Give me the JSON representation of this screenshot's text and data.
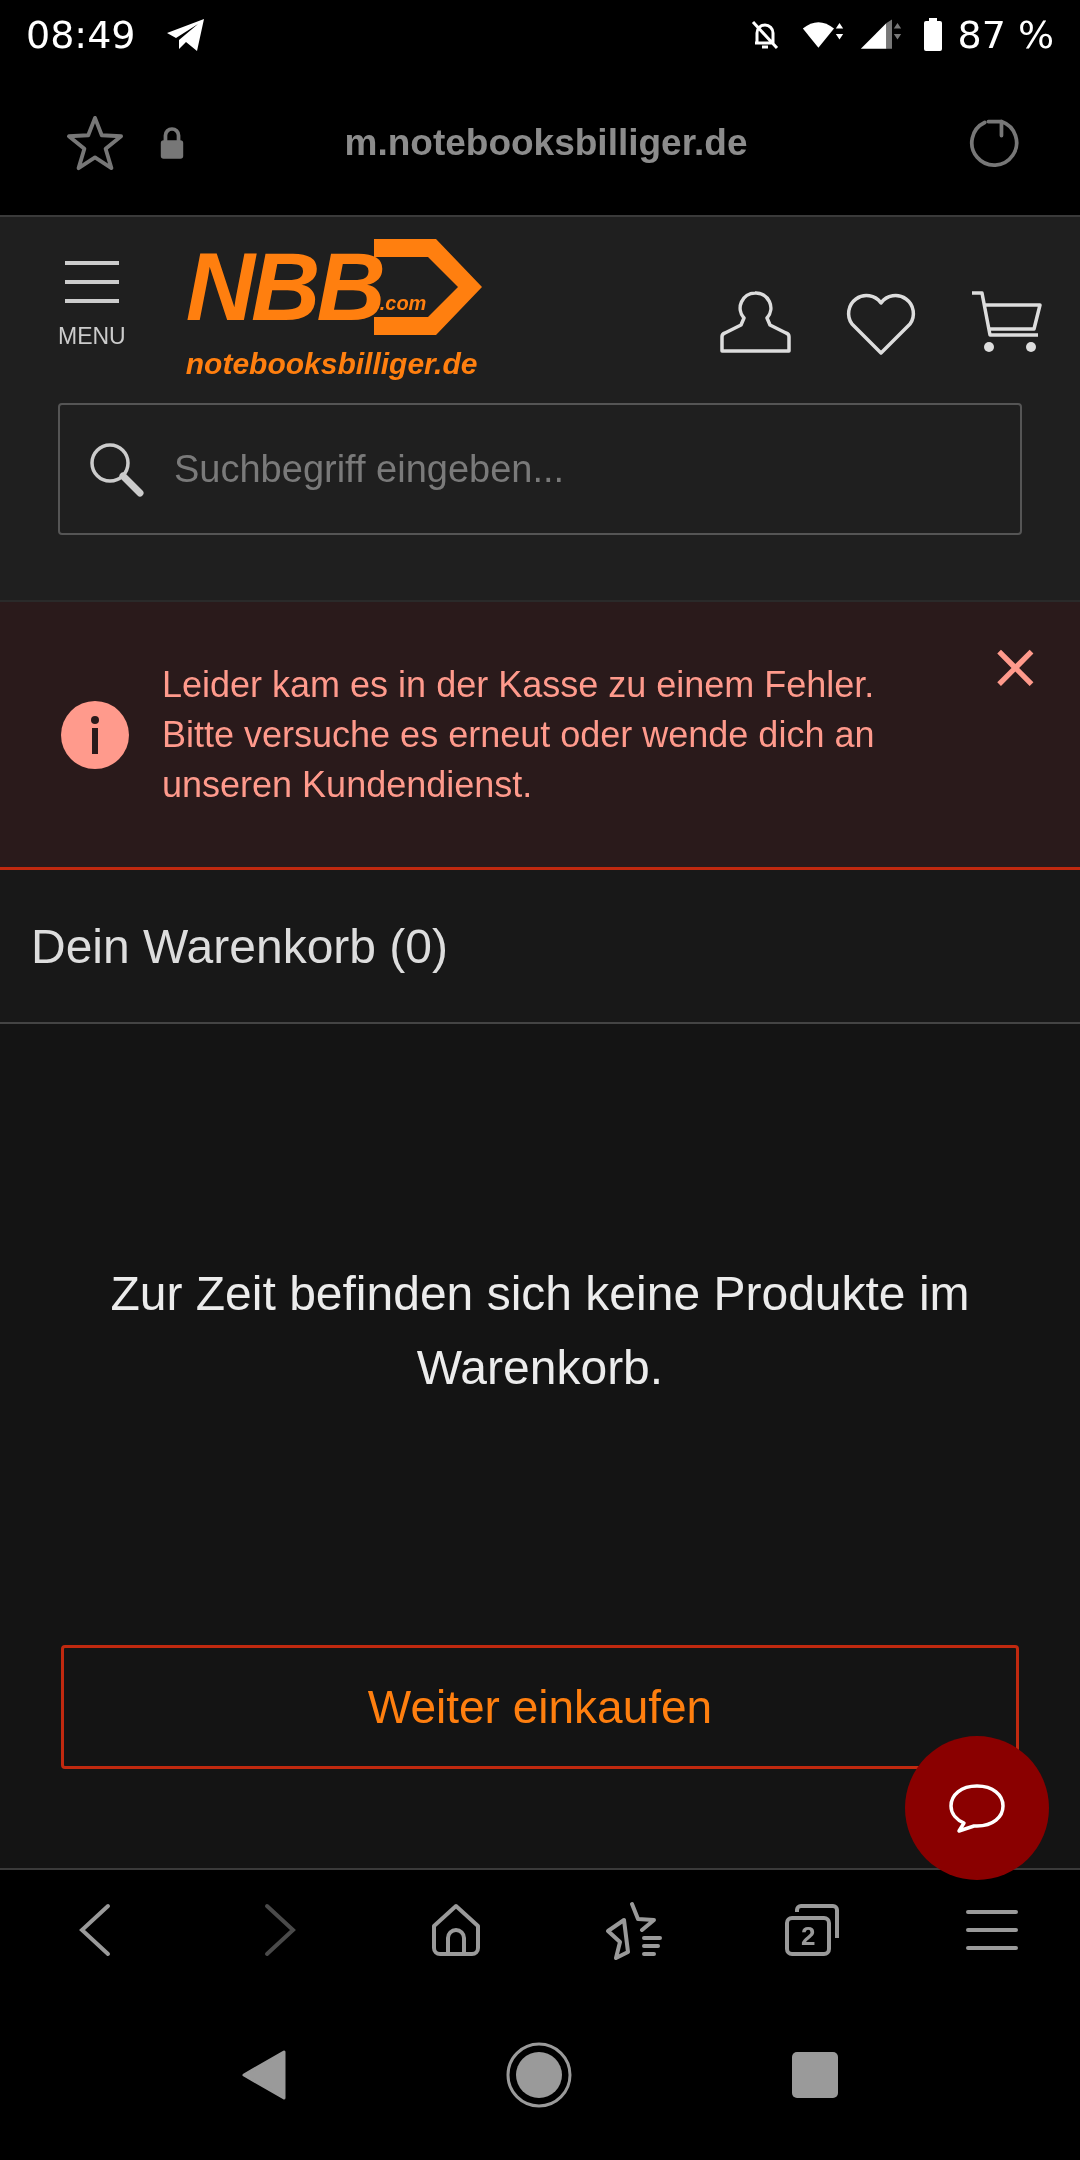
{
  "status_bar": {
    "time": "08:49",
    "battery": "87 %"
  },
  "url_bar": {
    "url": "m.notebooksbilliger.de"
  },
  "header": {
    "menu_label": "MENU",
    "logo": {
      "mark": "NBB",
      "suffix": ".com",
      "wordmark": "notebooksbilliger.de"
    }
  },
  "search": {
    "placeholder": "Suchbegriff eingeben..."
  },
  "alert": {
    "message": "Leider kam es in der Kasse zu einem Fehler. Bitte versuche es erneut oder wende dich an unseren Kundendienst.",
    "close": "×"
  },
  "cart": {
    "title": "Dein Warenkorb (0)",
    "empty_message": "Zur Zeit befinden sich keine Produkte im Warenkorb.",
    "button": "Weiter einkaufen"
  },
  "browser_toolbar": {
    "back_disabled": false,
    "forward_disabled": true,
    "tab_count": "2"
  }
}
